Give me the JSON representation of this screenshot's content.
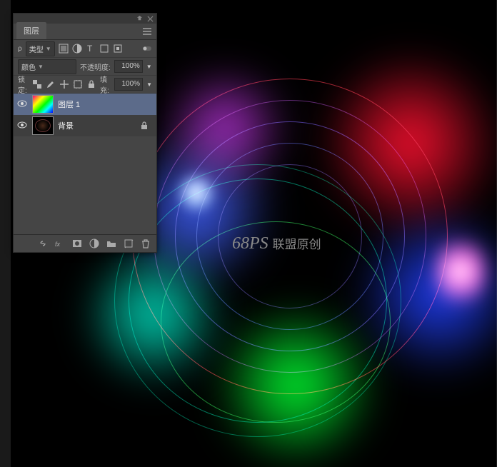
{
  "panel": {
    "tab": "图层",
    "filter_kind": "类型",
    "search_placeholder": "ρ",
    "blend_mode": "颜色",
    "opacity_label": "不透明度:",
    "opacity_value": "100%",
    "lock_label": "锁定:",
    "fill_label": "填充:",
    "fill_value": "100%",
    "layers": [
      {
        "name": "图层 1",
        "visible": true,
        "locked": false,
        "active": true,
        "thumb": "grad"
      },
      {
        "name": "背景",
        "visible": true,
        "locked": true,
        "active": false,
        "thumb": "bg"
      }
    ]
  },
  "watermark": {
    "logo": "68PS",
    "text": "联盟原创"
  }
}
